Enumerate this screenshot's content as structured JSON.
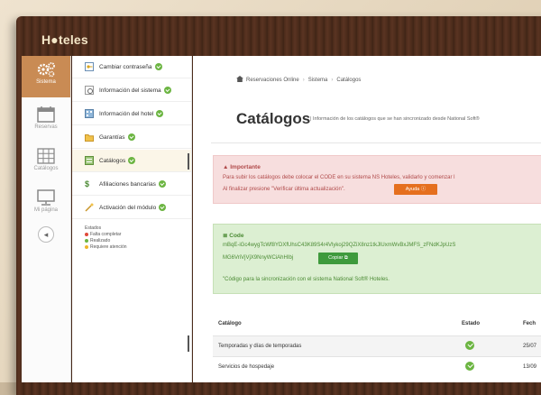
{
  "app": {
    "logo": "H●teles"
  },
  "rail": [
    {
      "label": "Sistema",
      "icon": "gear-icon",
      "active": true
    },
    {
      "label": "Reservas",
      "icon": "calendar-icon"
    },
    {
      "label": "Catálogos",
      "icon": "grid-icon"
    },
    {
      "label": "Mi página",
      "icon": "monitor-icon"
    }
  ],
  "menu": {
    "items": [
      {
        "label": "Cambiar contraseña",
        "icon": "key-icon"
      },
      {
        "label": "Información del sistema",
        "icon": "info-icon"
      },
      {
        "label": "Información del hotel",
        "icon": "building-icon"
      },
      {
        "label": "Garantías",
        "icon": "folder-icon"
      },
      {
        "label": "Catálogos",
        "icon": "list-icon",
        "active": true
      },
      {
        "label": "Afiliaciones bancarias",
        "icon": "dollar-icon"
      },
      {
        "label": "Activación del módulo",
        "icon": "wand-icon"
      }
    ],
    "legend": {
      "title": "Estados",
      "items": [
        "Falta completar",
        "Realizado",
        "Requiere atención"
      ],
      "colors": [
        "#e04a3a",
        "#6cb542",
        "#f0b429"
      ]
    }
  },
  "breadcrumb": [
    "Reservaciones Online",
    "Sistema",
    "Catálogos"
  ],
  "page": {
    "title": "Catálogos",
    "subtitle": "| Información de los catálogos que se han sincronizado desde National Soft®"
  },
  "alert": {
    "heading": "▲ Importante",
    "line1": "Para subir los catálogos debe colocar el CODE en su sistema NS Hoteles, validarlo y comenzar l",
    "line2": "Al finalizar presione \"Verificar última actualización\".",
    "help_button": "Ayuda ⓘ"
  },
  "code": {
    "heading": "≣ Code",
    "line1": "mBqE-iGc4wygTcWf8YDXfUhsC43K89S4r4Vlykoj29QZiX8nz1tkJlUxmWvBxJMFS_zFNdKJpUzS",
    "line2": "MG6VriVjVjX9NnyWCiAhHIbj",
    "copy_button": "Copiar ⧉",
    "note": "\"Código para la sincronización con el sistema National Soft® Hoteles."
  },
  "table": {
    "headers": {
      "catalog": "Catálogo",
      "status": "Estado",
      "date": "Fech"
    },
    "rows": [
      {
        "catalog": "Temporadas y días de temporadas",
        "date": "25/07"
      },
      {
        "catalog": "Servicios de hospedaje",
        "date": "13/09"
      }
    ]
  }
}
